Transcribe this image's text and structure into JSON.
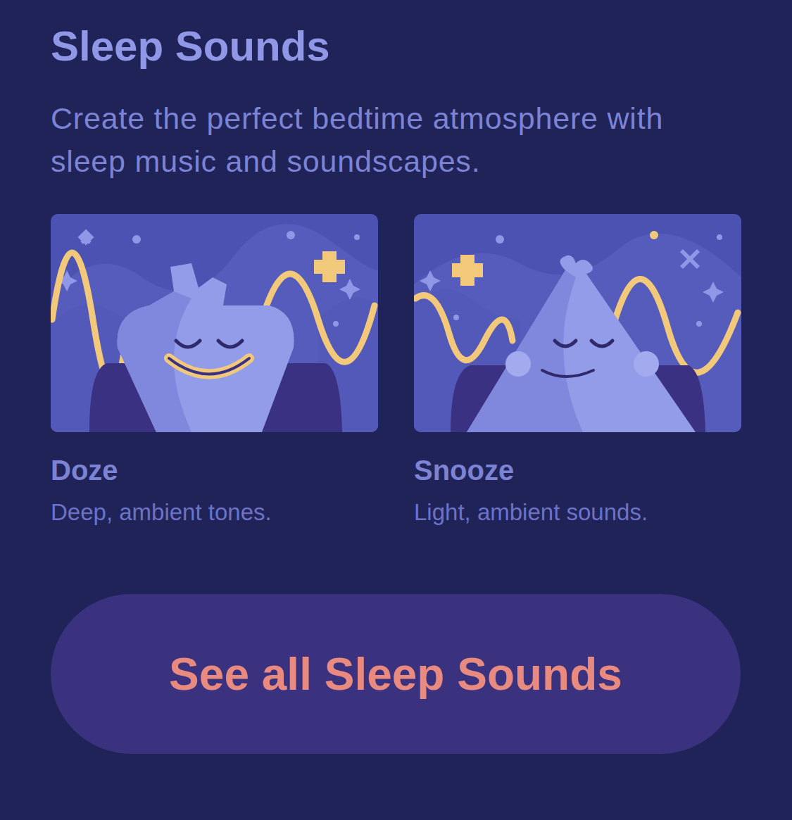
{
  "section": {
    "title": "Sleep Sounds",
    "description": "Create the perfect bedtime atmosphere with sleep music and soundscapes."
  },
  "items": [
    {
      "kind": "doze",
      "title": "Doze",
      "subtitle": "Deep, ambient tones."
    },
    {
      "kind": "snooze",
      "title": "Snooze",
      "subtitle": "Light, ambient sounds."
    }
  ],
  "button": {
    "label": "See all Sleep Sounds"
  }
}
